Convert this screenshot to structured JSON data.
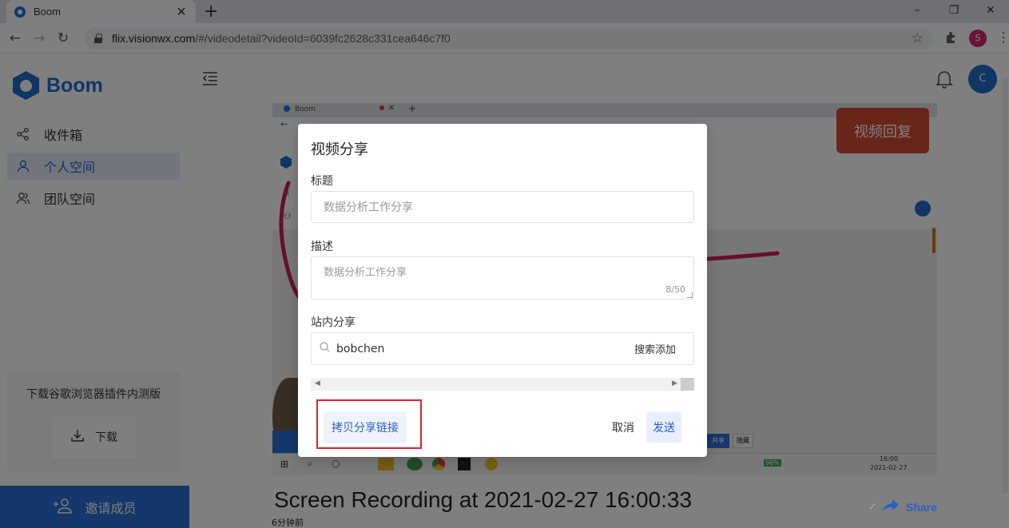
{
  "browser": {
    "tab_title": "Boom",
    "url_host": "flix.visionwx.com",
    "url_path": "/#/videodetail?videoId=6039fc2628c331cea646c7f0",
    "profile_initial": "S",
    "window_controls": [
      "–",
      "❐",
      "✕"
    ]
  },
  "sidebar": {
    "logo_text": "Boom",
    "items": [
      {
        "label": "收件箱",
        "icon": "share-icon",
        "active": false
      },
      {
        "label": "个人空间",
        "icon": "user-icon",
        "active": true
      },
      {
        "label": "团队空间",
        "icon": "team-icon",
        "active": false
      }
    ],
    "plugin_text": "下载谷歌浏览器插件内测版",
    "download_label": "下载",
    "invite_label": "邀请成员"
  },
  "header": {
    "user_initial": "C"
  },
  "video": {
    "reply_button": "视频回复",
    "title": "Screen Recording at 2021-02-27 16:00:33",
    "time_ago": "6分钟前",
    "share_label": "Share",
    "inner_tab_title": "Boom",
    "inner_clock_time": "16:00",
    "inner_clock_date": "2021-02-27",
    "inner_battery": "96%",
    "inner_share_btn": "共享",
    "inner_hide_btn": "隐藏"
  },
  "modal": {
    "title": "视频分享",
    "title_label": "标题",
    "title_placeholder": "数据分析工作分享",
    "desc_label": "描述",
    "desc_placeholder": "数据分析工作分享",
    "desc_counter": "8/50",
    "share_label": "站内分享",
    "search_value": "bobchen",
    "search_add": "搜索添加",
    "copy_link": "拷贝分享链接",
    "cancel": "取消",
    "send": "发送"
  },
  "colors": {
    "brand": "#1f6dc9",
    "invite_bar": "#2b6fd6",
    "reply_button": "#d44b36",
    "highlight_border": "#e0202a"
  }
}
